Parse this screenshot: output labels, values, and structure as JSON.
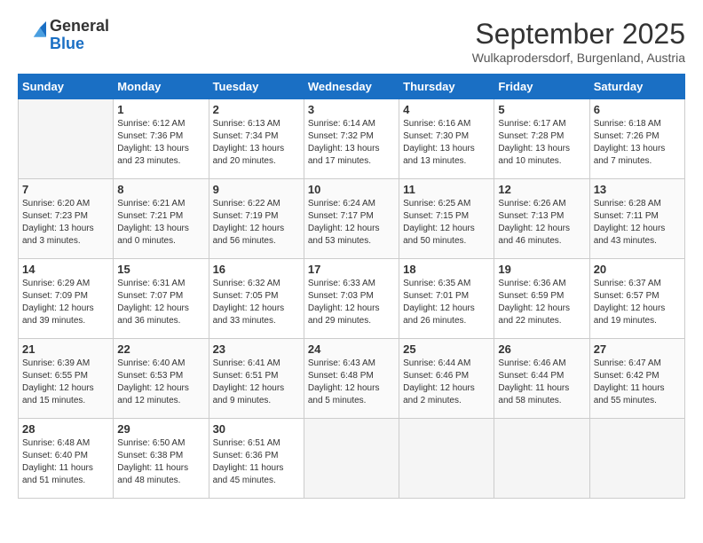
{
  "header": {
    "logo_general": "General",
    "logo_blue": "Blue",
    "month_title": "September 2025",
    "subtitle": "Wulkaprodersdorf, Burgenland, Austria"
  },
  "weekdays": [
    "Sunday",
    "Monday",
    "Tuesday",
    "Wednesday",
    "Thursday",
    "Friday",
    "Saturday"
  ],
  "weeks": [
    [
      {
        "day": "",
        "sunrise": "",
        "sunset": "",
        "daylight": ""
      },
      {
        "day": "1",
        "sunrise": "Sunrise: 6:12 AM",
        "sunset": "Sunset: 7:36 PM",
        "daylight": "Daylight: 13 hours and 23 minutes."
      },
      {
        "day": "2",
        "sunrise": "Sunrise: 6:13 AM",
        "sunset": "Sunset: 7:34 PM",
        "daylight": "Daylight: 13 hours and 20 minutes."
      },
      {
        "day": "3",
        "sunrise": "Sunrise: 6:14 AM",
        "sunset": "Sunset: 7:32 PM",
        "daylight": "Daylight: 13 hours and 17 minutes."
      },
      {
        "day": "4",
        "sunrise": "Sunrise: 6:16 AM",
        "sunset": "Sunset: 7:30 PM",
        "daylight": "Daylight: 13 hours and 13 minutes."
      },
      {
        "day": "5",
        "sunrise": "Sunrise: 6:17 AM",
        "sunset": "Sunset: 7:28 PM",
        "daylight": "Daylight: 13 hours and 10 minutes."
      },
      {
        "day": "6",
        "sunrise": "Sunrise: 6:18 AM",
        "sunset": "Sunset: 7:26 PM",
        "daylight": "Daylight: 13 hours and 7 minutes."
      }
    ],
    [
      {
        "day": "7",
        "sunrise": "Sunrise: 6:20 AM",
        "sunset": "Sunset: 7:23 PM",
        "daylight": "Daylight: 13 hours and 3 minutes."
      },
      {
        "day": "8",
        "sunrise": "Sunrise: 6:21 AM",
        "sunset": "Sunset: 7:21 PM",
        "daylight": "Daylight: 13 hours and 0 minutes."
      },
      {
        "day": "9",
        "sunrise": "Sunrise: 6:22 AM",
        "sunset": "Sunset: 7:19 PM",
        "daylight": "Daylight: 12 hours and 56 minutes."
      },
      {
        "day": "10",
        "sunrise": "Sunrise: 6:24 AM",
        "sunset": "Sunset: 7:17 PM",
        "daylight": "Daylight: 12 hours and 53 minutes."
      },
      {
        "day": "11",
        "sunrise": "Sunrise: 6:25 AM",
        "sunset": "Sunset: 7:15 PM",
        "daylight": "Daylight: 12 hours and 50 minutes."
      },
      {
        "day": "12",
        "sunrise": "Sunrise: 6:26 AM",
        "sunset": "Sunset: 7:13 PM",
        "daylight": "Daylight: 12 hours and 46 minutes."
      },
      {
        "day": "13",
        "sunrise": "Sunrise: 6:28 AM",
        "sunset": "Sunset: 7:11 PM",
        "daylight": "Daylight: 12 hours and 43 minutes."
      }
    ],
    [
      {
        "day": "14",
        "sunrise": "Sunrise: 6:29 AM",
        "sunset": "Sunset: 7:09 PM",
        "daylight": "Daylight: 12 hours and 39 minutes."
      },
      {
        "day": "15",
        "sunrise": "Sunrise: 6:31 AM",
        "sunset": "Sunset: 7:07 PM",
        "daylight": "Daylight: 12 hours and 36 minutes."
      },
      {
        "day": "16",
        "sunrise": "Sunrise: 6:32 AM",
        "sunset": "Sunset: 7:05 PM",
        "daylight": "Daylight: 12 hours and 33 minutes."
      },
      {
        "day": "17",
        "sunrise": "Sunrise: 6:33 AM",
        "sunset": "Sunset: 7:03 PM",
        "daylight": "Daylight: 12 hours and 29 minutes."
      },
      {
        "day": "18",
        "sunrise": "Sunrise: 6:35 AM",
        "sunset": "Sunset: 7:01 PM",
        "daylight": "Daylight: 12 hours and 26 minutes."
      },
      {
        "day": "19",
        "sunrise": "Sunrise: 6:36 AM",
        "sunset": "Sunset: 6:59 PM",
        "daylight": "Daylight: 12 hours and 22 minutes."
      },
      {
        "day": "20",
        "sunrise": "Sunrise: 6:37 AM",
        "sunset": "Sunset: 6:57 PM",
        "daylight": "Daylight: 12 hours and 19 minutes."
      }
    ],
    [
      {
        "day": "21",
        "sunrise": "Sunrise: 6:39 AM",
        "sunset": "Sunset: 6:55 PM",
        "daylight": "Daylight: 12 hours and 15 minutes."
      },
      {
        "day": "22",
        "sunrise": "Sunrise: 6:40 AM",
        "sunset": "Sunset: 6:53 PM",
        "daylight": "Daylight: 12 hours and 12 minutes."
      },
      {
        "day": "23",
        "sunrise": "Sunrise: 6:41 AM",
        "sunset": "Sunset: 6:51 PM",
        "daylight": "Daylight: 12 hours and 9 minutes."
      },
      {
        "day": "24",
        "sunrise": "Sunrise: 6:43 AM",
        "sunset": "Sunset: 6:48 PM",
        "daylight": "Daylight: 12 hours and 5 minutes."
      },
      {
        "day": "25",
        "sunrise": "Sunrise: 6:44 AM",
        "sunset": "Sunset: 6:46 PM",
        "daylight": "Daylight: 12 hours and 2 minutes."
      },
      {
        "day": "26",
        "sunrise": "Sunrise: 6:46 AM",
        "sunset": "Sunset: 6:44 PM",
        "daylight": "Daylight: 11 hours and 58 minutes."
      },
      {
        "day": "27",
        "sunrise": "Sunrise: 6:47 AM",
        "sunset": "Sunset: 6:42 PM",
        "daylight": "Daylight: 11 hours and 55 minutes."
      }
    ],
    [
      {
        "day": "28",
        "sunrise": "Sunrise: 6:48 AM",
        "sunset": "Sunset: 6:40 PM",
        "daylight": "Daylight: 11 hours and 51 minutes."
      },
      {
        "day": "29",
        "sunrise": "Sunrise: 6:50 AM",
        "sunset": "Sunset: 6:38 PM",
        "daylight": "Daylight: 11 hours and 48 minutes."
      },
      {
        "day": "30",
        "sunrise": "Sunrise: 6:51 AM",
        "sunset": "Sunset: 6:36 PM",
        "daylight": "Daylight: 11 hours and 45 minutes."
      },
      {
        "day": "",
        "sunrise": "",
        "sunset": "",
        "daylight": ""
      },
      {
        "day": "",
        "sunrise": "",
        "sunset": "",
        "daylight": ""
      },
      {
        "day": "",
        "sunrise": "",
        "sunset": "",
        "daylight": ""
      },
      {
        "day": "",
        "sunrise": "",
        "sunset": "",
        "daylight": ""
      }
    ]
  ]
}
